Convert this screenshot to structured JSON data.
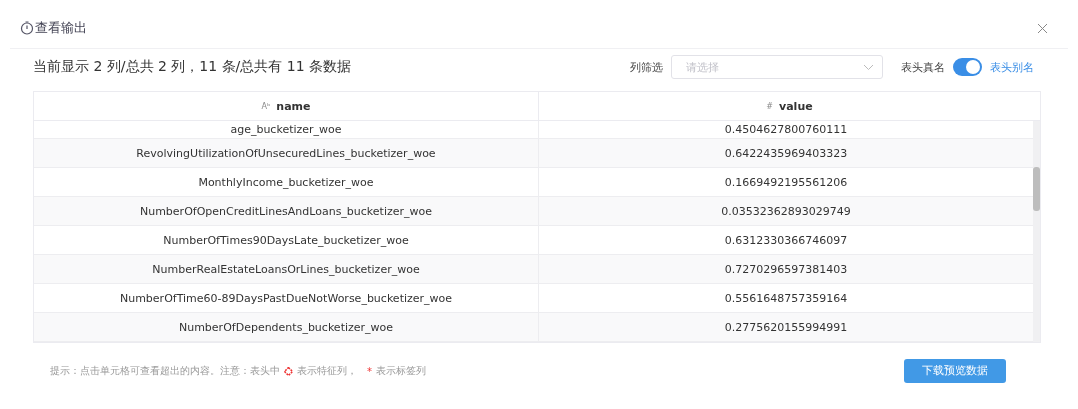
{
  "dialog": {
    "title": "查看输出"
  },
  "summary": "当前显示 2 列/总共 2 列，11 条/总共有 11 条数据",
  "filter": {
    "label": "列筛选",
    "placeholder": "请选择"
  },
  "header_toggle": {
    "off_label": "表头真名",
    "on_label": "表头别名",
    "on": true
  },
  "table": {
    "columns": [
      {
        "label": "name",
        "type_mark": "Aᵇ"
      },
      {
        "label": "value",
        "type_mark": "#"
      }
    ],
    "rows": [
      {
        "name": "age_bucketizer_woe",
        "value": "0.4504627800760111"
      },
      {
        "name": "RevolvingUtilizationOfUnsecuredLines_bucketizer_woe",
        "value": "0.6422435969403323"
      },
      {
        "name": "MonthlyIncome_bucketizer_woe",
        "value": "0.1669492195561206"
      },
      {
        "name": "NumberOfOpenCreditLinesAndLoans_bucketizer_woe",
        "value": "0.03532362893029749"
      },
      {
        "name": "NumberOfTimes90DaysLate_bucketizer_woe",
        "value": "0.6312330366746097"
      },
      {
        "name": "NumberRealEstateLoansOrLines_bucketizer_woe",
        "value": "0.7270296597381403"
      },
      {
        "name": "NumberOfTime60-89DaysPastDueNotWorse_bucketizer_woe",
        "value": "0.5561648757359164"
      },
      {
        "name": "NumberOfDependents_bucketizer_woe",
        "value": "0.2775620155994991"
      }
    ]
  },
  "hint": {
    "text_1": "提示：点击单元格可查看超出的内容。注意：表头中",
    "text_2": "表示特征列，",
    "label_mark": "*",
    "text_3": "表示标签列"
  },
  "download_button": "下载预览数据"
}
